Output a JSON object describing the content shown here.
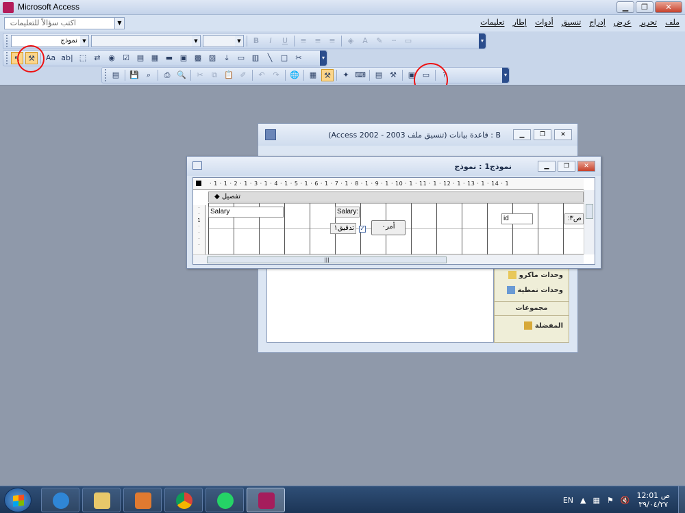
{
  "app": {
    "title": "Microsoft Access"
  },
  "window_controls": {
    "minimize": "▁",
    "restore": "❐",
    "close": "✕"
  },
  "help": {
    "placeholder": "اكتب سؤالاً للتعليمات"
  },
  "menus": [
    "ملف",
    "تحرير",
    "عرض",
    "إدراج",
    "تنسيق",
    "أدوات",
    "إطار",
    "تعليمات"
  ],
  "formatting_toolbar": {
    "object_combo": "نموذج",
    "bold": "B",
    "italic": "I",
    "underline": "U"
  },
  "toolbox": {
    "label_tool": "Aa",
    "textbox_tool": "ab|"
  },
  "db_window": {
    "title": "B : قاعدة بيانات (تنسيق ملف Access 2002 - 2003)",
    "sidebar": {
      "macros": "وحدات ماكرو",
      "modules": "وحدات نمطية",
      "groups_header": "مجموعات",
      "favorites": "المفضلة"
    }
  },
  "form_window": {
    "title": "نموذج1 : نموذج",
    "section_detail": "تفصيل",
    "ruler": "· 1 · 1 · 2 · 1 · 3 · 1 · 4 · 1 · 5 · 1 · 6 · 1 · 7 · 1 · 8 · 1 · 9 · 1 · 10 · 1 · 11 · 1 · 12 · 1 · 13 · 1 · 14 · 1",
    "controls": {
      "salary_textbox": "Salary",
      "salary_label": "Salary:",
      "id_textbox": "id",
      "partial_label": "ص٣:",
      "checkbox_label": "تدقيق١",
      "command_button": "أمر٠"
    }
  },
  "taskbar": {
    "language": "EN",
    "time": "12:01 ص",
    "date": "٣٩/٠٤/٢٧"
  }
}
